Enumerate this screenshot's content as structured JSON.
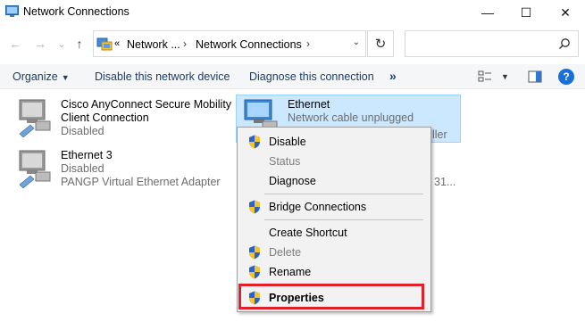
{
  "window": {
    "title": "Network Connections",
    "minimize": "—",
    "maximize": "☐",
    "close": "✕"
  },
  "nav": {
    "back": "←",
    "forward": "→",
    "recent": "⌄",
    "up": "↑",
    "breadcrumb": {
      "overflow": "«",
      "parent": "Network ...",
      "sep1": "›",
      "current": "Network Connections",
      "sep2": "›"
    },
    "refresh": "↻",
    "search_placeholder": ""
  },
  "toolbar": {
    "organize": "Organize",
    "organize_caret": "▼",
    "disable_device": "Disable this network device",
    "diagnose": "Diagnose this connection",
    "more": "»",
    "view_caret": "▼",
    "help": "?"
  },
  "connections": [
    {
      "name_line1": "Cisco AnyConnect Secure Mobility",
      "name_line2": "Client Connection",
      "status": "Disabled"
    },
    {
      "name": "Ethernet",
      "status": "Network cable unplugged",
      "adapter_tail": "ller"
    },
    {
      "name": "Ethernet 3",
      "status": "Disabled",
      "adapter": "PANGP Virtual Ethernet Adapter",
      "adapter_tail": "31..."
    }
  ],
  "context_menu": {
    "items": [
      {
        "label": "Disable",
        "shield": true,
        "enabled": true
      },
      {
        "label": "Status",
        "shield": false,
        "enabled": false
      },
      {
        "label": "Diagnose",
        "shield": false,
        "enabled": true
      },
      {
        "label": "Bridge Connections",
        "shield": true,
        "enabled": true
      },
      {
        "label": "Create Shortcut",
        "shield": false,
        "enabled": true
      },
      {
        "label": "Delete",
        "shield": true,
        "enabled": false
      },
      {
        "label": "Rename",
        "shield": true,
        "enabled": true
      },
      {
        "label": "Properties",
        "shield": true,
        "enabled": true,
        "default": true
      }
    ]
  },
  "colors": {
    "selection": "#cce8ff",
    "highlight_border": "#e0202a",
    "command_text": "#1a3e6d",
    "disabled_text": "#7d7d7d"
  }
}
